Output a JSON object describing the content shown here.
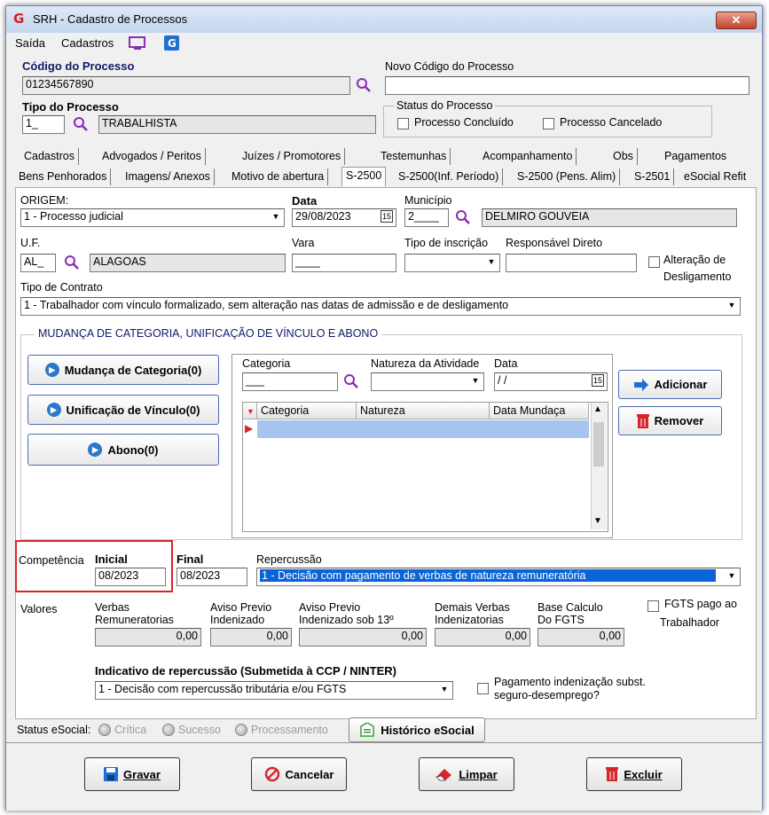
{
  "window": {
    "title": "SRH - Cadastro de Processos",
    "close": "✕"
  },
  "menu": {
    "saida": "Saída",
    "cadastros": "Cadastros"
  },
  "header": {
    "codigo_label": "Código do Processo",
    "codigo_value": "01234567890",
    "novo_codigo_label": "Novo Código do Processo",
    "novo_codigo_value": "",
    "tipo_label": "Tipo do Processo",
    "tipo_code": "1_",
    "tipo_desc": "TRABALHISTA",
    "status_group": "Status do Processo",
    "concluido": "Processo Concluído",
    "cancelado": "Processo Cancelado"
  },
  "tabs_row1": [
    "Cadastros",
    "Advogados / Peritos",
    "Juízes / Promotores",
    "Testemunhas",
    "Acompanhamento",
    "Obs",
    "Pagamentos"
  ],
  "tabs_row2": [
    "Bens Penhorados",
    "Imagens/ Anexos",
    "Motivo de abertura",
    "S-2500",
    "S-2500(Inf. Período)",
    "S-2500 (Pens. Alim)",
    "S-2501",
    "eSocial Refit"
  ],
  "form": {
    "origem_label": "ORIGEM:",
    "origem_value": "1 - Processo judicial",
    "data_label": "Data",
    "data_value": "29/08/2023",
    "municipio_label": "Município",
    "municipio_code": "2____",
    "municipio_desc": "DELMIRO GOUVEIA",
    "uf_label": "U.F.",
    "uf_code": "AL_",
    "uf_desc": "ALAGOAS",
    "vara_label": "Vara",
    "vara_value": "____",
    "tipo_inscricao_label": "Tipo de inscrição",
    "responsavel_label": "Responsável Direto",
    "alteracao_label": "Alteração de",
    "alteracao_label2": "Desligamento",
    "tipo_contrato_label": "Tipo de Contrato",
    "tipo_contrato_value": "1 - Trabalhador com vínculo formalizado, sem alteração nas datas de admissão e de desligamento"
  },
  "mudanca": {
    "group_title": "MUDANÇA DE CATEGORIA, UNIFICAÇÃO DE VÍNCULO E ABONO",
    "btn_mudanca": "Mudança de Categoria(0)",
    "btn_unificacao": "Unificação de Vínculo(0)",
    "btn_abono": "Abono(0)",
    "categoria_label": "Categoria",
    "categoria_value": "___",
    "natureza_label": "Natureza da Atividade",
    "data_label": "Data",
    "data_value": " / /",
    "btn_adicionar": "Adicionar",
    "btn_remover": "Remover",
    "grid_cols": [
      "Categoria",
      "Natureza",
      "Data Mundaça"
    ]
  },
  "competencia": {
    "label": "Competência",
    "inicial_label": "Inicial",
    "inicial_value": "08/2023",
    "final_label": "Final",
    "final_value": "08/2023",
    "repercussao_label": "Repercussão",
    "repercussao_value": "1 - Decisão com pagamento de verbas de natureza remuneratória"
  },
  "valores": {
    "label": "Valores",
    "verbas_l1": "Verbas",
    "verbas_l2": "Remuneratorias",
    "verbas_value": "0,00",
    "aviso_l1": "Aviso Previo",
    "aviso_l2": "Indenizado",
    "aviso_value": "0,00",
    "aviso13_l1": "Aviso Previo",
    "aviso13_l2": "Indenizado sob 13º",
    "aviso13_value": "0,00",
    "demais_l1": "Demais Verbas",
    "demais_l2": "Indenizatorias",
    "demais_value": "0,00",
    "base_l1": "Base Calculo",
    "base_l2": "Do FGTS",
    "base_value": "0,00",
    "fgts_l1": "FGTS pago ao",
    "fgts_l2": "Trabalhador"
  },
  "indicativo": {
    "label": "Indicativo de repercussão (Submetida à CCP / NINTER)",
    "value": "1 - Decisão com repercussão tributária e/ou FGTS",
    "pagamento_l1": "Pagamento indenização subst.",
    "pagamento_l2": "seguro-desemprego?"
  },
  "status": {
    "label": "Status eSocial:",
    "critica": "Crítica",
    "sucesso": "Sucesso",
    "processamento": "Processamento",
    "historico": "Histórico eSocial"
  },
  "actions": {
    "gravar": "Gravar",
    "cancelar": "Cancelar",
    "limpar": "Limpar",
    "excluir": "Excluir"
  },
  "colors": {
    "accent": "#0d1a66",
    "selection": "#0a64d8",
    "danger": "#d7262b",
    "search": "#8a2ab5"
  }
}
